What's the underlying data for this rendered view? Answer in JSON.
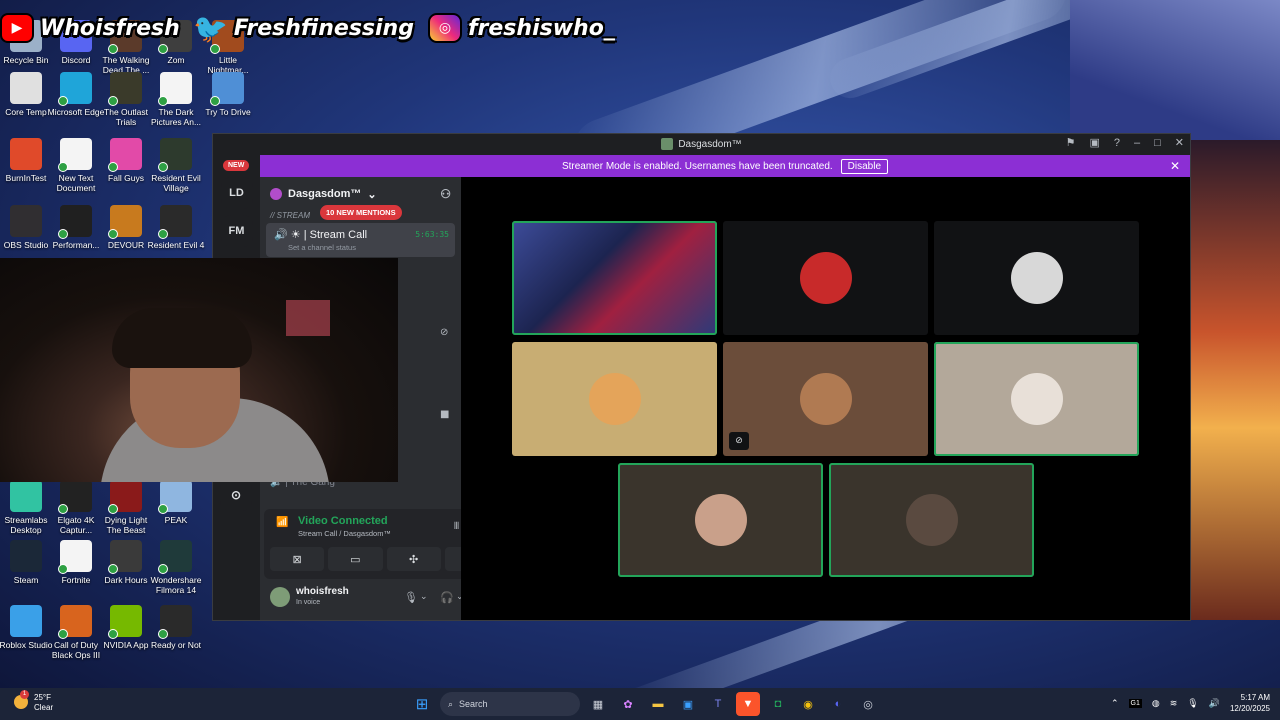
{
  "overlay": {
    "youtube": "Whoisfresh",
    "twitter": "Freshfinessing",
    "instagram": "freshiswho_"
  },
  "desktop_icons": [
    {
      "label": "Recycle Bin",
      "color": "#9bb0c8"
    },
    {
      "label": "Discord",
      "color": "#5865f2"
    },
    {
      "label": "The Walking Dead The ...",
      "color": "#5b3a2a"
    },
    {
      "label": "Zom",
      "color": "#3e3e3e"
    },
    {
      "label": "Little Nightmar...",
      "color": "#a14b1e"
    },
    {
      "label": "Core Temp",
      "color": "#e0e0e0"
    },
    {
      "label": "Microsoft Edge",
      "color": "#1fa5d9"
    },
    {
      "label": "The Outlast Trials",
      "color": "#3a3a2a"
    },
    {
      "label": "The Dark Pictures An...",
      "color": "#f4f4f4"
    },
    {
      "label": "Try To Drive",
      "color": "#4f8fd6"
    },
    {
      "label": "BurnInTest",
      "color": "#e04a2a"
    },
    {
      "label": "New Text Document",
      "color": "#f4f4f4"
    },
    {
      "label": "Fall Guys",
      "color": "#e24aa8"
    },
    {
      "label": "Resident Evil Village",
      "color": "#2d3a2d"
    },
    {
      "label": "OBS Studio",
      "color": "#302e31"
    },
    {
      "label": "Performan...",
      "color": "#202020"
    },
    {
      "label": "DEVOUR",
      "color": "#c87a1e"
    },
    {
      "label": "Resident Evil 4",
      "color": "#2a2a2a"
    },
    {
      "label": "Streamlabs Desktop",
      "color": "#31c3a2"
    },
    {
      "label": "Elgato 4K Captur...",
      "color": "#222222"
    },
    {
      "label": "Dying Light The Beast",
      "color": "#8a1a1a"
    },
    {
      "label": "PEAK",
      "color": "#8fb6e0"
    },
    {
      "label": "Steam",
      "color": "#1b2838"
    },
    {
      "label": "Fortnite",
      "color": "#f4f4f4"
    },
    {
      "label": "Dark Hours",
      "color": "#3a3a3a"
    },
    {
      "label": "Wondershare Filmora 14",
      "color": "#1f3a3a"
    },
    {
      "label": "Roblox Studio",
      "color": "#3aa0e8"
    },
    {
      "label": "Call of Duty Black Ops III",
      "color": "#d8641e"
    },
    {
      "label": "NVIDIA App",
      "color": "#76b900"
    },
    {
      "label": "Ready or Not",
      "color": "#2a2a2a"
    }
  ],
  "window": {
    "title": "Dasgasdom™",
    "streamer_notice": "Streamer Mode is enabled. Usernames have been truncated.",
    "disable_label": "Disable"
  },
  "rail": {
    "new_badge": "NEW",
    "items": [
      "LD",
      "FM"
    ]
  },
  "sidebar": {
    "server_name": "Dasgasdom™",
    "category": "// STREAM",
    "mentions": "10 NEW MENTIONS",
    "voice_channel": "Stream Call",
    "set_status": "Set a channel status",
    "timer": "5:63:35",
    "other_channel": "The Gang"
  },
  "connection": {
    "status": "Video Connected",
    "location": "Stream Call / Dasgasdom™"
  },
  "user": {
    "name": "whoisfresh",
    "status": "In voice"
  },
  "video_tiles": [
    {
      "bg": "#2b3a7a",
      "avatar": "",
      "speaking": true,
      "muted": false
    },
    {
      "bg": "#111214",
      "avatar": "#c82a2a",
      "speaking": false,
      "muted": false
    },
    {
      "bg": "#111214",
      "avatar": "#d8d8d8",
      "speaking": false,
      "muted": false
    },
    {
      "bg": "#c8ad73",
      "avatar": "#e4a45a",
      "speaking": false,
      "muted": false
    },
    {
      "bg": "#6b4d3a",
      "avatar": "#b07a52",
      "speaking": false,
      "muted": true
    },
    {
      "bg": "#b3a89a",
      "avatar": "#e8e0d8",
      "speaking": true,
      "muted": false
    },
    {
      "bg": "#3a342c",
      "avatar": "#c9a08a",
      "speaking": true,
      "muted": false
    },
    {
      "bg": "#3a342c",
      "avatar": "#5a4a40",
      "speaking": true,
      "muted": false
    }
  ],
  "taskbar": {
    "weather_temp": "25°F",
    "weather_desc": "Clear",
    "weather_badge": "1",
    "search_placeholder": "Search",
    "tray_lang": "G1",
    "time": "5:17 AM",
    "date": "12/20/2025"
  }
}
